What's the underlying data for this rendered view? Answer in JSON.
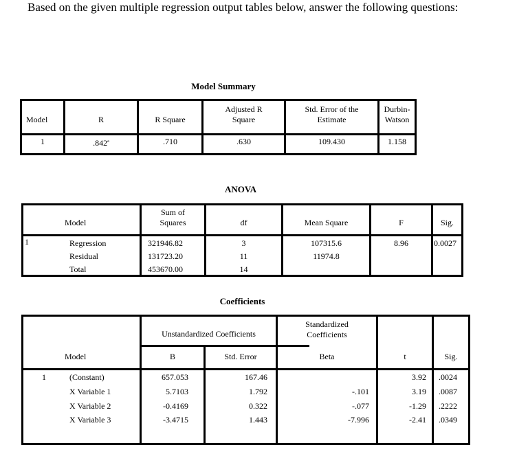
{
  "intro": "Based on the given multiple regression output tables below, answer the following questions:",
  "model_summary": {
    "title": "Model Summary",
    "headers": [
      "Model",
      "R",
      "R Square",
      "Adjusted R Square",
      "Std. Error of the Estimate",
      "Durbin-Watson"
    ],
    "headers_lines": {
      "adj": [
        "Adjusted R",
        "Square"
      ],
      "se": [
        "Std. Error of the",
        "Estimate"
      ],
      "dw": [
        "Durbin-",
        "Watson"
      ]
    },
    "row": {
      "model": "1",
      "r": ".842",
      "r_footnote": "a",
      "r_square": ".710",
      "adj_r_square": ".630",
      "std_error": "109.430",
      "durbin_watson": "1.158"
    }
  },
  "anova": {
    "title": "ANOVA",
    "headers": {
      "model": "Model",
      "ss_line1": "Sum of",
      "ss_line2": "Squares",
      "df": "df",
      "ms": "Mean Square",
      "f": "F",
      "sig": "Sig."
    },
    "model_number": "1",
    "rows": [
      {
        "label": "Regression",
        "ss": "321946.82",
        "df": "3",
        "ms": "107315.6",
        "f": "8.96",
        "sig": "0.0027"
      },
      {
        "label": "Residual",
        "ss": "131723.20",
        "df": "11",
        "ms": "11974.8",
        "f": "",
        "sig": ""
      },
      {
        "label": "Total",
        "ss": "453670.00",
        "df": "14",
        "ms": "",
        "f": "",
        "sig": ""
      }
    ]
  },
  "coefficients": {
    "title": "Coefficients",
    "headers": {
      "model": "Model",
      "unstd": "Unstandardized Coefficients",
      "std_line1": "Standardized",
      "std_line2": "Coefficients",
      "b": "B",
      "se": "Std. Error",
      "beta": "Beta",
      "t": "t",
      "sig": "Sig."
    },
    "model_number": "1",
    "rows": [
      {
        "label": "(Constant)",
        "b": "657.053",
        "se": "167.46",
        "beta": "",
        "t": "3.92",
        "sig": ".0024"
      },
      {
        "label": "X Variable 1",
        "b": "5.7103",
        "se": "1.792",
        "beta": "-.101",
        "t": "3.19",
        "sig": ".0087"
      },
      {
        "label": "X Variable 2",
        "b": "-0.4169",
        "se": "0.322",
        "beta": "-.077",
        "t": "-1.29",
        "sig": ".2222"
      },
      {
        "label": "X Variable 3",
        "b": "-3.4715",
        "se": "1.443",
        "beta": "-7.996",
        "t": "-2.41",
        "sig": ".0349"
      }
    ]
  }
}
